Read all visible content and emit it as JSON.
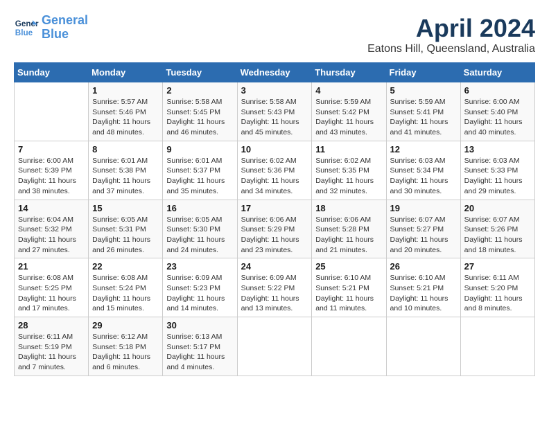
{
  "logo": {
    "line1": "General",
    "line2": "Blue"
  },
  "title": "April 2024",
  "subtitle": "Eatons Hill, Queensland, Australia",
  "weekdays": [
    "Sunday",
    "Monday",
    "Tuesday",
    "Wednesday",
    "Thursday",
    "Friday",
    "Saturday"
  ],
  "weeks": [
    [
      {
        "day": "",
        "info": ""
      },
      {
        "day": "1",
        "info": "Sunrise: 5:57 AM\nSunset: 5:46 PM\nDaylight: 11 hours\nand 48 minutes."
      },
      {
        "day": "2",
        "info": "Sunrise: 5:58 AM\nSunset: 5:45 PM\nDaylight: 11 hours\nand 46 minutes."
      },
      {
        "day": "3",
        "info": "Sunrise: 5:58 AM\nSunset: 5:43 PM\nDaylight: 11 hours\nand 45 minutes."
      },
      {
        "day": "4",
        "info": "Sunrise: 5:59 AM\nSunset: 5:42 PM\nDaylight: 11 hours\nand 43 minutes."
      },
      {
        "day": "5",
        "info": "Sunrise: 5:59 AM\nSunset: 5:41 PM\nDaylight: 11 hours\nand 41 minutes."
      },
      {
        "day": "6",
        "info": "Sunrise: 6:00 AM\nSunset: 5:40 PM\nDaylight: 11 hours\nand 40 minutes."
      }
    ],
    [
      {
        "day": "7",
        "info": "Sunrise: 6:00 AM\nSunset: 5:39 PM\nDaylight: 11 hours\nand 38 minutes."
      },
      {
        "day": "8",
        "info": "Sunrise: 6:01 AM\nSunset: 5:38 PM\nDaylight: 11 hours\nand 37 minutes."
      },
      {
        "day": "9",
        "info": "Sunrise: 6:01 AM\nSunset: 5:37 PM\nDaylight: 11 hours\nand 35 minutes."
      },
      {
        "day": "10",
        "info": "Sunrise: 6:02 AM\nSunset: 5:36 PM\nDaylight: 11 hours\nand 34 minutes."
      },
      {
        "day": "11",
        "info": "Sunrise: 6:02 AM\nSunset: 5:35 PM\nDaylight: 11 hours\nand 32 minutes."
      },
      {
        "day": "12",
        "info": "Sunrise: 6:03 AM\nSunset: 5:34 PM\nDaylight: 11 hours\nand 30 minutes."
      },
      {
        "day": "13",
        "info": "Sunrise: 6:03 AM\nSunset: 5:33 PM\nDaylight: 11 hours\nand 29 minutes."
      }
    ],
    [
      {
        "day": "14",
        "info": "Sunrise: 6:04 AM\nSunset: 5:32 PM\nDaylight: 11 hours\nand 27 minutes."
      },
      {
        "day": "15",
        "info": "Sunrise: 6:05 AM\nSunset: 5:31 PM\nDaylight: 11 hours\nand 26 minutes."
      },
      {
        "day": "16",
        "info": "Sunrise: 6:05 AM\nSunset: 5:30 PM\nDaylight: 11 hours\nand 24 minutes."
      },
      {
        "day": "17",
        "info": "Sunrise: 6:06 AM\nSunset: 5:29 PM\nDaylight: 11 hours\nand 23 minutes."
      },
      {
        "day": "18",
        "info": "Sunrise: 6:06 AM\nSunset: 5:28 PM\nDaylight: 11 hours\nand 21 minutes."
      },
      {
        "day": "19",
        "info": "Sunrise: 6:07 AM\nSunset: 5:27 PM\nDaylight: 11 hours\nand 20 minutes."
      },
      {
        "day": "20",
        "info": "Sunrise: 6:07 AM\nSunset: 5:26 PM\nDaylight: 11 hours\nand 18 minutes."
      }
    ],
    [
      {
        "day": "21",
        "info": "Sunrise: 6:08 AM\nSunset: 5:25 PM\nDaylight: 11 hours\nand 17 minutes."
      },
      {
        "day": "22",
        "info": "Sunrise: 6:08 AM\nSunset: 5:24 PM\nDaylight: 11 hours\nand 15 minutes."
      },
      {
        "day": "23",
        "info": "Sunrise: 6:09 AM\nSunset: 5:23 PM\nDaylight: 11 hours\nand 14 minutes."
      },
      {
        "day": "24",
        "info": "Sunrise: 6:09 AM\nSunset: 5:22 PM\nDaylight: 11 hours\nand 13 minutes."
      },
      {
        "day": "25",
        "info": "Sunrise: 6:10 AM\nSunset: 5:21 PM\nDaylight: 11 hours\nand 11 minutes."
      },
      {
        "day": "26",
        "info": "Sunrise: 6:10 AM\nSunset: 5:21 PM\nDaylight: 11 hours\nand 10 minutes."
      },
      {
        "day": "27",
        "info": "Sunrise: 6:11 AM\nSunset: 5:20 PM\nDaylight: 11 hours\nand 8 minutes."
      }
    ],
    [
      {
        "day": "28",
        "info": "Sunrise: 6:11 AM\nSunset: 5:19 PM\nDaylight: 11 hours\nand 7 minutes."
      },
      {
        "day": "29",
        "info": "Sunrise: 6:12 AM\nSunset: 5:18 PM\nDaylight: 11 hours\nand 6 minutes."
      },
      {
        "day": "30",
        "info": "Sunrise: 6:13 AM\nSunset: 5:17 PM\nDaylight: 11 hours\nand 4 minutes."
      },
      {
        "day": "",
        "info": ""
      },
      {
        "day": "",
        "info": ""
      },
      {
        "day": "",
        "info": ""
      },
      {
        "day": "",
        "info": ""
      }
    ]
  ]
}
